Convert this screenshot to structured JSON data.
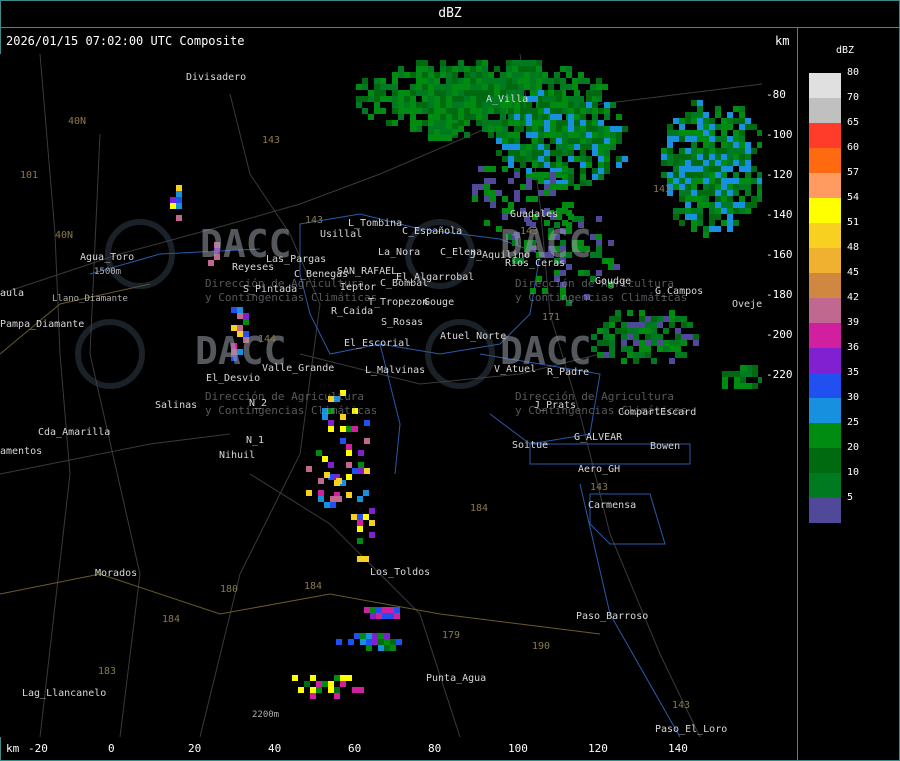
{
  "title": "dBZ",
  "header": "2026/01/15 07:02:00 UTC Composite",
  "km_label": "km",
  "legend": {
    "unit": "dBZ",
    "entries": [
      {
        "value": "80",
        "color": "#e0e0e0"
      },
      {
        "value": "70",
        "color": "#c0c0c0"
      },
      {
        "value": "65",
        "color": "#ff3b2a"
      },
      {
        "value": "60",
        "color": "#ff6a10"
      },
      {
        "value": "57",
        "color": "#ff9a60"
      },
      {
        "value": "54",
        "color": "#ffff00"
      },
      {
        "value": "51",
        "color": "#f8d020"
      },
      {
        "value": "48",
        "color": "#f0b030"
      },
      {
        "value": "45",
        "color": "#d08840"
      },
      {
        "value": "42",
        "color": "#c06890"
      },
      {
        "value": "39",
        "color": "#d020a0"
      },
      {
        "value": "36",
        "color": "#8020d0"
      },
      {
        "value": "35",
        "color": "#2050f0"
      },
      {
        "value": "30",
        "color": "#1890e0"
      },
      {
        "value": "25",
        "color": "#008c10"
      },
      {
        "value": "20",
        "color": "#006a10"
      },
      {
        "value": "10",
        "color": "#007a20"
      },
      {
        "value": "5",
        "color": "#504898"
      }
    ]
  },
  "y_axis_ticks": [
    "-80",
    "-100",
    "-120",
    "-140",
    "-160",
    "-180",
    "-200",
    "-220"
  ],
  "x_axis_ticks": [
    "-20",
    "0",
    "20",
    "40",
    "60",
    "80",
    "100",
    "120",
    "140"
  ],
  "places": [
    "Divisadero",
    "A_Villa",
    "Guadales",
    "L_Tombina",
    "Usillal",
    "C_Española",
    "La_Nora",
    "C_Elena",
    "J_Aquilino",
    "Rios_Ceras",
    "C_Benegas",
    "SAN_RAFAEL",
    "El_Algarrobal",
    "C_Bombal",
    "Ieptor",
    "Reyeses",
    "Las_Pargas",
    "S_Pintada",
    "R_Caida",
    "T_Tropezon",
    "Gouge",
    "S_Rosas",
    "Atuel_Norte",
    "G_Campos",
    "Goudge",
    "Ovejeria",
    "El_Escorial",
    "L_Malvinas",
    "V_Atuel",
    "R_Padre",
    "Valle_Grande",
    "El_Desvio",
    "Salinas",
    "N_2",
    "N_1",
    "Nihuil",
    "J_Prats",
    "CompartEscard",
    "G_ALVEAR",
    "Bowen",
    "Soitue",
    "Aero_GH",
    "Carmensa",
    "Agua_Toro",
    "aula",
    "Pampa_Diamante",
    "Cda_Amarilla",
    "Los_Toldos",
    "Morados",
    "Paso_Barroso",
    "Punta_Agua",
    "Lag_Llancanelo",
    "Paso_El_Loro",
    "Llano_Diamante",
    "amentos",
    "1500m",
    "2200m"
  ],
  "routes": [
    "40N",
    "40N",
    "143",
    "101",
    "143",
    "143",
    "144",
    "143",
    "180",
    "184",
    "184",
    "179",
    "190",
    "143",
    "184",
    "183",
    "143",
    "171"
  ],
  "watermark": {
    "brand": "DACC",
    "line1": "Dirección de Agricultura",
    "line2": "y Contingencias Climáticas"
  }
}
